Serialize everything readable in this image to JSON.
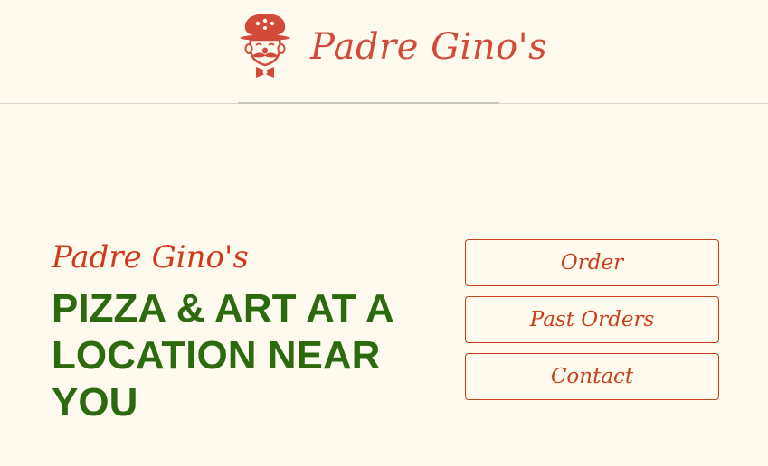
{
  "header": {
    "brand_name": "Padre  Gino's",
    "logo_icon": "chef-mascot-icon"
  },
  "hero": {
    "subtitle": "Padre Gino's",
    "title": "PIZZA & ART AT A LOCATION NEAR YOU"
  },
  "nav": {
    "items": [
      {
        "label": "Order"
      },
      {
        "label": "Past Orders"
      },
      {
        "label": "Contact"
      }
    ]
  },
  "colors": {
    "background": "#fefaee",
    "accent_red": "#d24a3a",
    "button_red": "#c8401e",
    "headline_green": "#2d6a0f"
  }
}
